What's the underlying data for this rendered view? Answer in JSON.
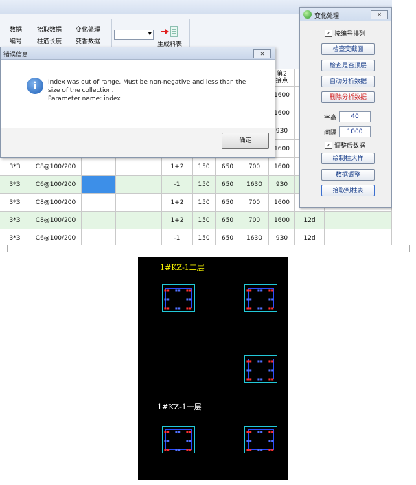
{
  "ribbon": {
    "row1": [
      "数据",
      "抬取数据",
      "变化处理"
    ],
    "row2": [
      "编号",
      "柱筋长度",
      "变香数据"
    ],
    "generate_label": "生成料表"
  },
  "grid": {
    "header": {
      "joint2_top": "第2",
      "joint2_bottom": "接点"
    },
    "rows": [
      {
        "c0": "",
        "c1": "",
        "c2": "",
        "c3": "",
        "c4": "",
        "c5": "",
        "c6": "",
        "c7": "",
        "c8": "1600",
        "c9": ""
      },
      {
        "c0": "",
        "c1": "",
        "c2": "",
        "c3": "",
        "c4": "",
        "c5": "",
        "c6": "",
        "c7": "",
        "c8": "1600",
        "c9": ""
      },
      {
        "c0": "",
        "c1": "",
        "c2": "",
        "c3": "",
        "c4": "",
        "c5": "",
        "c6": "",
        "c7": "",
        "c8": "930",
        "c9": ""
      },
      {
        "c0": "",
        "c1": "",
        "c2": "",
        "c3": "",
        "c4": "",
        "c5": "",
        "c6": "",
        "c7": "",
        "c8": "1600",
        "c9": ""
      },
      {
        "c0": "3*3",
        "c1": "C8@100/200",
        "c2": "",
        "c3": "",
        "c4": "1+2",
        "c5": "150",
        "c6": "650",
        "c7": "700",
        "c8": "1600",
        "c9": ""
      },
      {
        "c0": "3*3",
        "c1": "C6@100/200",
        "c2": "",
        "c3": "",
        "c4": "-1",
        "c5": "150",
        "c6": "650",
        "c7": "1630",
        "c8": "930",
        "c9": ""
      },
      {
        "c0": "3*3",
        "c1": "C8@100/200",
        "c2": "",
        "c3": "",
        "c4": "1+2",
        "c5": "150",
        "c6": "650",
        "c7": "700",
        "c8": "1600",
        "c9": ""
      },
      {
        "c0": "3*3",
        "c1": "C8@100/200",
        "c2": "",
        "c3": "",
        "c4": "1+2",
        "c5": "150",
        "c6": "650",
        "c7": "700",
        "c8": "1600",
        "c9": "12d"
      },
      {
        "c0": "3*3",
        "c1": "C6@100/200",
        "c2": "",
        "c3": "",
        "c4": "-1",
        "c5": "150",
        "c6": "650",
        "c7": "1630",
        "c8": "930",
        "c9": "12d"
      }
    ],
    "selected_color": "#3d8fe8",
    "row_green": "#e4f5e4"
  },
  "error_dialog": {
    "title": "错误信息",
    "close_label": "✕",
    "line1": "Index was out of range. Must be non-negative and less than the",
    "line2": "size of the collection.",
    "line3": "Parameter name: index",
    "ok_label": "确定",
    "icon": "info-icon"
  },
  "panel": {
    "title": "变化处理",
    "close_label": "✕",
    "sort_by_number": "按编号排列",
    "btn_check_section": "检查变截面",
    "btn_check_top": "检查是否顶层",
    "btn_auto_analyze": "自动分析数据",
    "btn_delete_analyze": "删除分析数据",
    "font_height_label": "字高",
    "font_height_value": "40",
    "spacing_label": "间隔",
    "spacing_value": "1000",
    "adjusted_data": "调整后数据",
    "btn_draw_column": "绘制柱大样",
    "btn_adjust_data": "数据调整",
    "btn_pick_table": "拾取到柱表",
    "delete_color": "#d01818"
  },
  "cad": {
    "title_top": "1#KZ-1二层",
    "title_bottom": "1#KZ-1一层",
    "background": "#000000",
    "title_color": "#f5f000"
  }
}
